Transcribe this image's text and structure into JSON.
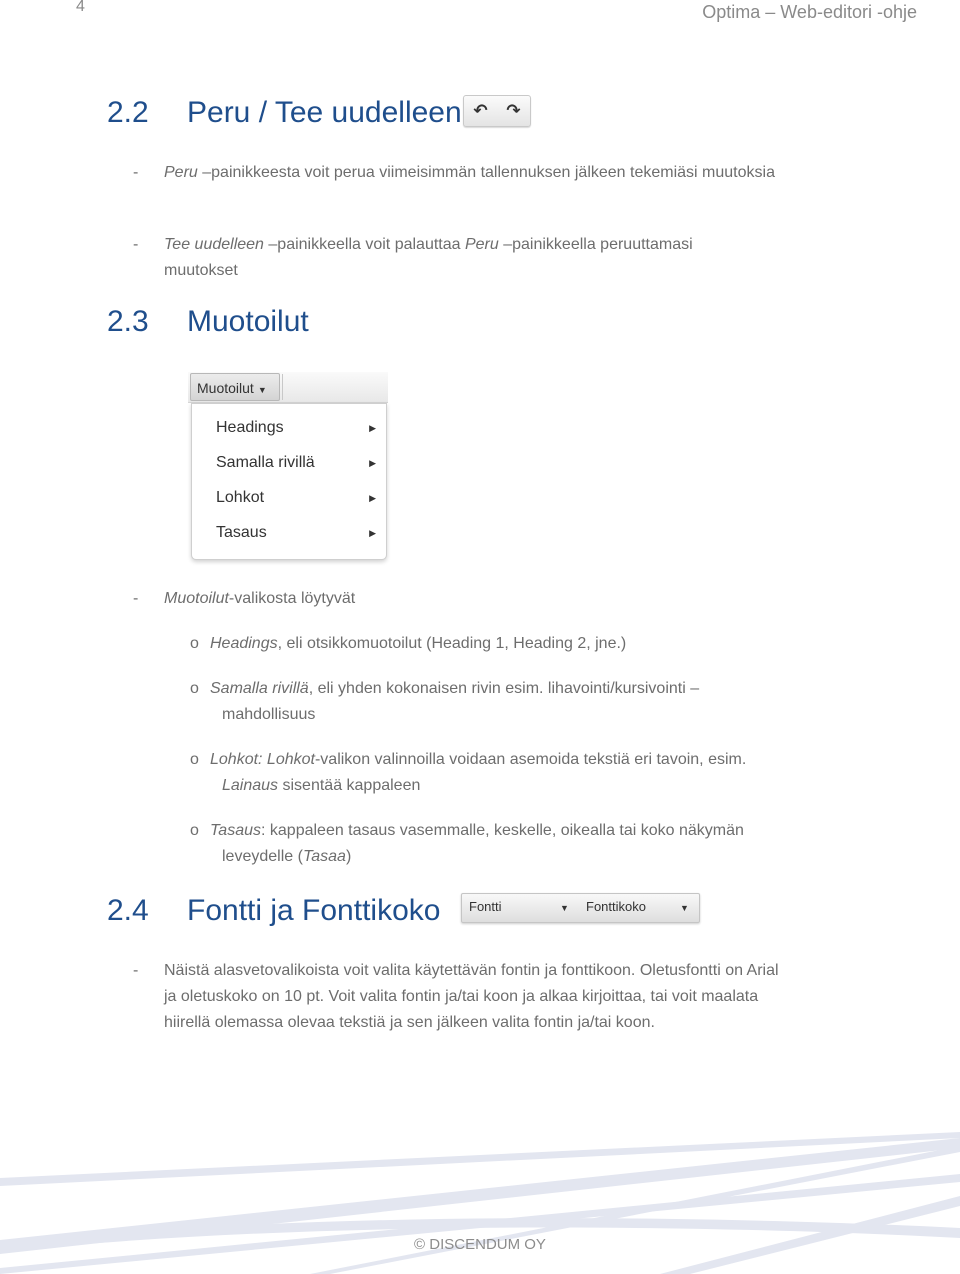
{
  "header": {
    "page_number": "4",
    "running_title": "Optima – Web-editori -ohje"
  },
  "sections": {
    "s22": {
      "number": "2.2",
      "title": "Peru / Tee uudelleen",
      "toolbar_icons": [
        "undo-icon",
        "redo-icon"
      ],
      "undo_glyph": "↶",
      "redo_glyph": "↷",
      "bullets": [
        {
          "em": "Peru",
          "text": " –painikkeesta voit perua viimeisimmän tallennuksen jälkeen tekemiäsi muutoksia"
        },
        {
          "em": "Tee uudelleen",
          "text_a": " –painikkeella voit palauttaa ",
          "em2": "Peru",
          "text_b": " –painikkeella peruuttamasi muutokset"
        }
      ]
    },
    "s23": {
      "number": "2.3",
      "title": "Muotoilut",
      "menu": {
        "button_label": "Muotoilut",
        "items": [
          "Headings",
          "Samalla rivillä",
          "Lohkot",
          "Tasaus"
        ]
      },
      "intro": {
        "em": "Muotoilut",
        "text": "-valikosta löytyvät"
      },
      "subitems": [
        {
          "em": "Headings",
          "text": ", eli otsikkomuotoilut (Heading 1, Heading 2, jne.)"
        },
        {
          "em": "Samalla rivillä",
          "text": ", eli yhden kokonaisen rivin esim. lihavointi/kursivointi –",
          "cont": "mahdollisuus"
        },
        {
          "em": "Lohkot: Lohkot",
          "text": "-valikon valinnoilla voidaan asemoida tekstiä eri tavoin, esim.",
          "cont_em": "Lainaus",
          "cont": " sisentää kappaleen"
        },
        {
          "em": "Tasaus",
          "text": ": kappaleen tasaus vasemmalle, keskelle, oikealla tai koko näkymän",
          "cont": "leveydelle (",
          "cont_em": "Tasaa",
          "cont_end": ")"
        }
      ]
    },
    "s24": {
      "number": "2.4",
      "title": "Fontti ja Fonttikoko",
      "font_select": "Fontti",
      "size_select": "Fonttikoko",
      "bullet": "Näistä alasvetovalikoista voit valita käytettävän fontin ja fonttikoon. Oletusfontti on Arial ja oletuskoko on 10 pt. Voit valita fontin ja/tai koon ja alkaa kirjoittaa, tai voit maalata hiirellä olemassa olevaa tekstiä ja sen jälkeen valita fontin ja/tai koon."
    }
  },
  "footer": {
    "copyright": "© DISCENDUM OY",
    "swoosh_color": "#e3e6f0"
  },
  "glyphs": {
    "dash": "-",
    "circle": "o",
    "caret_down": "▼",
    "caret_right": "▶"
  },
  "colors": {
    "heading": "#1f4e8c",
    "body": "#6d6d6d"
  }
}
